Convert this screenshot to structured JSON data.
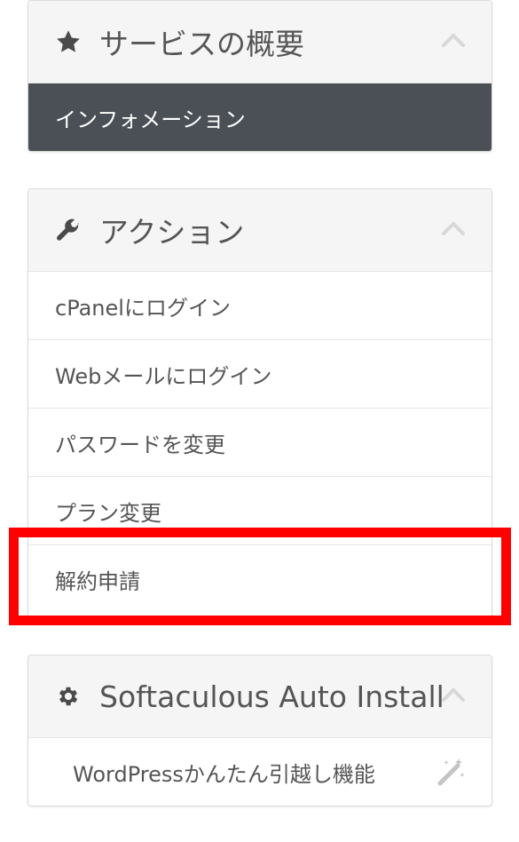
{
  "service_panel": {
    "title": "サービスの概要",
    "icon": "star-icon",
    "items": [
      {
        "label": "インフォメーション",
        "active": true
      }
    ]
  },
  "actions_panel": {
    "title": "アクション",
    "icon": "wrench-icon",
    "items": [
      {
        "label": "cPanelにログイン"
      },
      {
        "label": "Webメールにログイン"
      },
      {
        "label": "パスワードを変更"
      },
      {
        "label": "プラン変更"
      },
      {
        "label": "解約申請"
      }
    ]
  },
  "softaculous_panel": {
    "title": "Softaculous Auto Install",
    "icon": "gear-icon",
    "items": [
      {
        "label": "WordPressかんたん引越し機能",
        "icon": "magic-wand-icon"
      }
    ]
  },
  "colors": {
    "active_bg": "#4a5055",
    "header_bg": "#f5f5f5",
    "highlight": "#ff0000"
  }
}
